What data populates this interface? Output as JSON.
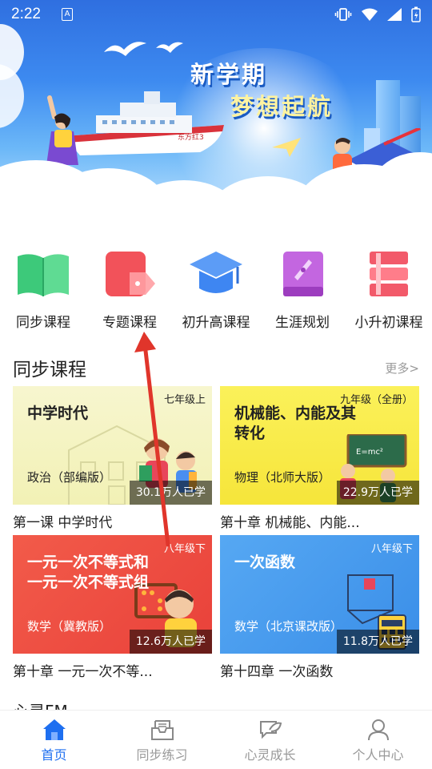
{
  "status_bar": {
    "time": "2:22",
    "indicator": "A"
  },
  "banner": {
    "line1": "新学期",
    "line2": "梦想起航",
    "ship_text": "东方红3"
  },
  "quick_nav": [
    {
      "label": "同步课程",
      "icon": "green-book-icon",
      "color": "#3dc97a"
    },
    {
      "label": "专题课程",
      "icon": "red-tag-icon",
      "color": "#f2525a"
    },
    {
      "label": "初升高课程",
      "icon": "graduation-cap-icon",
      "color": "#3e86f2"
    },
    {
      "label": "生涯规划",
      "icon": "compass-book-icon",
      "color": "#b14fd6"
    },
    {
      "label": "小升初课程",
      "icon": "red-books-icon",
      "color": "#f25a6a"
    }
  ],
  "section": {
    "title": "同步课程",
    "more": "更多>"
  },
  "courses": [
    {
      "grade": "七年级上",
      "heading": "中学时代",
      "subject": "政治（部编版）",
      "learners": "30.1万人已学",
      "title": "第一课 中学时代"
    },
    {
      "grade": "九年级（全册）",
      "heading": "机械能、内能及其转化",
      "subject": "物理（北师大版）",
      "learners": "22.9万人已学",
      "title": "第十章 机械能、内能..."
    },
    {
      "grade": "八年级下",
      "heading": "一元一次不等式和一元一次不等式组",
      "subject": "数学（冀教版）",
      "learners": "12.6万人已学",
      "title": "第十章 一元一次不等..."
    },
    {
      "grade": "八年级下",
      "heading": "一次函数",
      "subject": "数学（北京课改版）",
      "learners": "11.8万人已学",
      "title": "第十四章 一次函数"
    }
  ],
  "next_section": {
    "title": "心灵FM"
  },
  "bottom_nav": [
    {
      "label": "首页",
      "icon": "home-icon",
      "active": true
    },
    {
      "label": "同步练习",
      "icon": "inbox-icon",
      "active": false
    },
    {
      "label": "心灵成长",
      "icon": "leaf-chat-icon",
      "active": false
    },
    {
      "label": "个人中心",
      "icon": "person-icon",
      "active": false
    }
  ],
  "colors": {
    "accent": "#1e6ff0",
    "arrow": "#e0352b"
  }
}
